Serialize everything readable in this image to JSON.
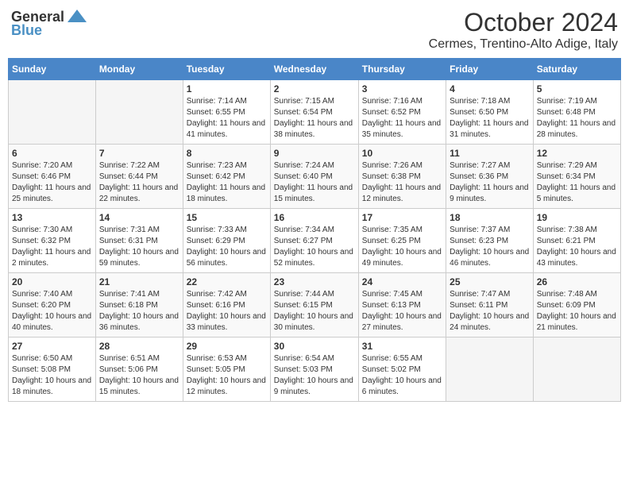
{
  "logo": {
    "general": "General",
    "blue": "Blue"
  },
  "title": "October 2024",
  "location": "Cermes, Trentino-Alto Adige, Italy",
  "days_of_week": [
    "Sunday",
    "Monday",
    "Tuesday",
    "Wednesday",
    "Thursday",
    "Friday",
    "Saturday"
  ],
  "weeks": [
    [
      {
        "day": "",
        "info": ""
      },
      {
        "day": "",
        "info": ""
      },
      {
        "day": "1",
        "info": "Sunrise: 7:14 AM\nSunset: 6:55 PM\nDaylight: 11 hours and 41 minutes."
      },
      {
        "day": "2",
        "info": "Sunrise: 7:15 AM\nSunset: 6:54 PM\nDaylight: 11 hours and 38 minutes."
      },
      {
        "day": "3",
        "info": "Sunrise: 7:16 AM\nSunset: 6:52 PM\nDaylight: 11 hours and 35 minutes."
      },
      {
        "day": "4",
        "info": "Sunrise: 7:18 AM\nSunset: 6:50 PM\nDaylight: 11 hours and 31 minutes."
      },
      {
        "day": "5",
        "info": "Sunrise: 7:19 AM\nSunset: 6:48 PM\nDaylight: 11 hours and 28 minutes."
      }
    ],
    [
      {
        "day": "6",
        "info": "Sunrise: 7:20 AM\nSunset: 6:46 PM\nDaylight: 11 hours and 25 minutes."
      },
      {
        "day": "7",
        "info": "Sunrise: 7:22 AM\nSunset: 6:44 PM\nDaylight: 11 hours and 22 minutes."
      },
      {
        "day": "8",
        "info": "Sunrise: 7:23 AM\nSunset: 6:42 PM\nDaylight: 11 hours and 18 minutes."
      },
      {
        "day": "9",
        "info": "Sunrise: 7:24 AM\nSunset: 6:40 PM\nDaylight: 11 hours and 15 minutes."
      },
      {
        "day": "10",
        "info": "Sunrise: 7:26 AM\nSunset: 6:38 PM\nDaylight: 11 hours and 12 minutes."
      },
      {
        "day": "11",
        "info": "Sunrise: 7:27 AM\nSunset: 6:36 PM\nDaylight: 11 hours and 9 minutes."
      },
      {
        "day": "12",
        "info": "Sunrise: 7:29 AM\nSunset: 6:34 PM\nDaylight: 11 hours and 5 minutes."
      }
    ],
    [
      {
        "day": "13",
        "info": "Sunrise: 7:30 AM\nSunset: 6:32 PM\nDaylight: 11 hours and 2 minutes."
      },
      {
        "day": "14",
        "info": "Sunrise: 7:31 AM\nSunset: 6:31 PM\nDaylight: 10 hours and 59 minutes."
      },
      {
        "day": "15",
        "info": "Sunrise: 7:33 AM\nSunset: 6:29 PM\nDaylight: 10 hours and 56 minutes."
      },
      {
        "day": "16",
        "info": "Sunrise: 7:34 AM\nSunset: 6:27 PM\nDaylight: 10 hours and 52 minutes."
      },
      {
        "day": "17",
        "info": "Sunrise: 7:35 AM\nSunset: 6:25 PM\nDaylight: 10 hours and 49 minutes."
      },
      {
        "day": "18",
        "info": "Sunrise: 7:37 AM\nSunset: 6:23 PM\nDaylight: 10 hours and 46 minutes."
      },
      {
        "day": "19",
        "info": "Sunrise: 7:38 AM\nSunset: 6:21 PM\nDaylight: 10 hours and 43 minutes."
      }
    ],
    [
      {
        "day": "20",
        "info": "Sunrise: 7:40 AM\nSunset: 6:20 PM\nDaylight: 10 hours and 40 minutes."
      },
      {
        "day": "21",
        "info": "Sunrise: 7:41 AM\nSunset: 6:18 PM\nDaylight: 10 hours and 36 minutes."
      },
      {
        "day": "22",
        "info": "Sunrise: 7:42 AM\nSunset: 6:16 PM\nDaylight: 10 hours and 33 minutes."
      },
      {
        "day": "23",
        "info": "Sunrise: 7:44 AM\nSunset: 6:15 PM\nDaylight: 10 hours and 30 minutes."
      },
      {
        "day": "24",
        "info": "Sunrise: 7:45 AM\nSunset: 6:13 PM\nDaylight: 10 hours and 27 minutes."
      },
      {
        "day": "25",
        "info": "Sunrise: 7:47 AM\nSunset: 6:11 PM\nDaylight: 10 hours and 24 minutes."
      },
      {
        "day": "26",
        "info": "Sunrise: 7:48 AM\nSunset: 6:09 PM\nDaylight: 10 hours and 21 minutes."
      }
    ],
    [
      {
        "day": "27",
        "info": "Sunrise: 6:50 AM\nSunset: 5:08 PM\nDaylight: 10 hours and 18 minutes."
      },
      {
        "day": "28",
        "info": "Sunrise: 6:51 AM\nSunset: 5:06 PM\nDaylight: 10 hours and 15 minutes."
      },
      {
        "day": "29",
        "info": "Sunrise: 6:53 AM\nSunset: 5:05 PM\nDaylight: 10 hours and 12 minutes."
      },
      {
        "day": "30",
        "info": "Sunrise: 6:54 AM\nSunset: 5:03 PM\nDaylight: 10 hours and 9 minutes."
      },
      {
        "day": "31",
        "info": "Sunrise: 6:55 AM\nSunset: 5:02 PM\nDaylight: 10 hours and 6 minutes."
      },
      {
        "day": "",
        "info": ""
      },
      {
        "day": "",
        "info": ""
      }
    ]
  ]
}
